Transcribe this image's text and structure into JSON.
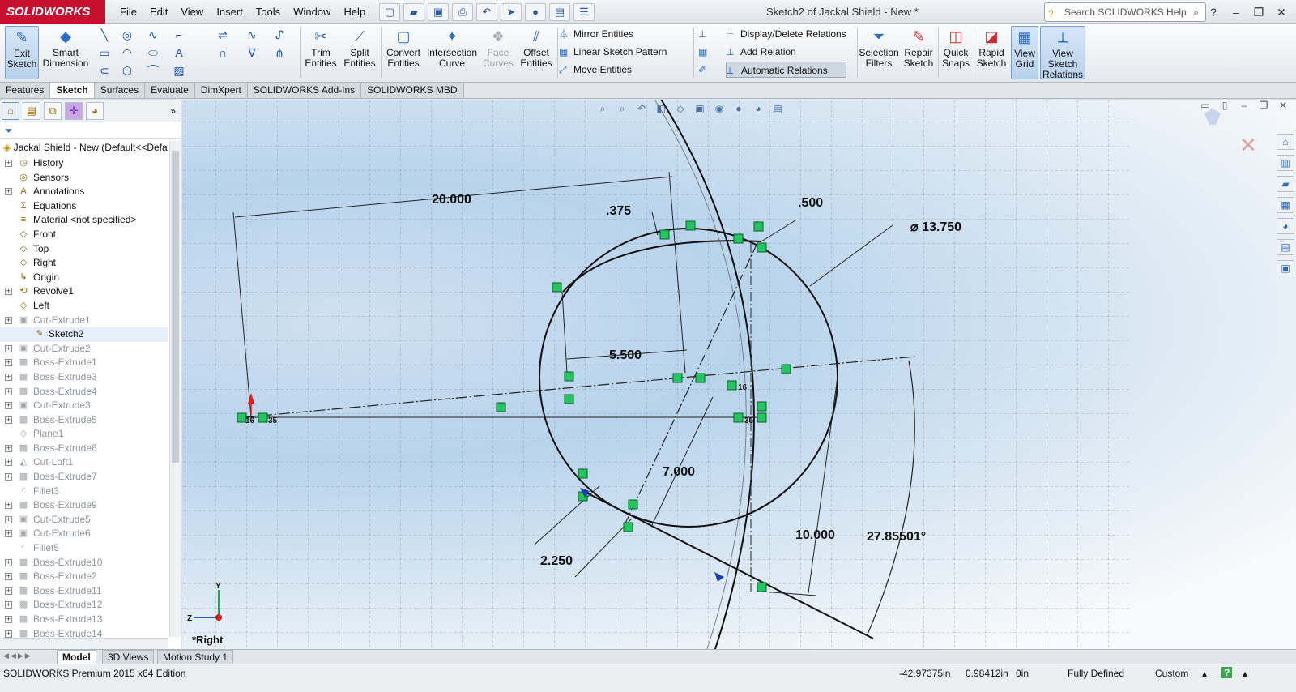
{
  "app": {
    "logo": "SOLIDWORKS",
    "document_title": "Sketch2 of Jackal Shield - New *"
  },
  "menu": [
    "File",
    "Edit",
    "View",
    "Insert",
    "Tools",
    "Window",
    "Help"
  ],
  "search": {
    "placeholder": "Search SOLIDWORKS Help"
  },
  "ribbon": {
    "exit_sketch": "Exit Sketch",
    "smart_dimension": "Smart Dimension",
    "trim_entities": "Trim Entities",
    "split_entities": "Split Entities",
    "convert_entities": "Convert Entities",
    "intersection_curve": "Intersection Curve",
    "face_curves": "Face Curves",
    "offset_entities": "Offset Entities",
    "mirror_entities": "Mirror Entities",
    "linear_sketch_pattern": "Linear Sketch Pattern",
    "move_entities": "Move Entities",
    "display_delete_relations": "Display/Delete Relations",
    "add_relation": "Add Relation",
    "automatic_relations": "Automatic Relations",
    "selection_filters": "Selection Filters",
    "repair_sketch": "Repair Sketch",
    "quick_snaps": "Quick Snaps",
    "rapid_sketch": "Rapid Sketch",
    "view_grid": "View Grid",
    "view_sketch_relations": "View Sketch Relations"
  },
  "command_tabs": [
    "Features",
    "Sketch",
    "Surfaces",
    "Evaluate",
    "DimXpert",
    "SOLIDWORKS Add-Ins",
    "SOLIDWORKS MBD"
  ],
  "tree": {
    "root": "Jackal Shield - New  (Default<<Defa",
    "items": [
      {
        "label": "History",
        "icon": "history-icon",
        "expandable": true,
        "dim": false
      },
      {
        "label": "Sensors",
        "icon": "sensor-icon",
        "expandable": false,
        "dim": false
      },
      {
        "label": "Annotations",
        "icon": "annotation-icon",
        "expandable": true,
        "dim": false
      },
      {
        "label": "Equations",
        "icon": "equation-icon",
        "expandable": false,
        "dim": false
      },
      {
        "label": "Material <not specified>",
        "icon": "material-icon",
        "expandable": false,
        "dim": false
      },
      {
        "label": "Front",
        "icon": "plane-icon",
        "expandable": false,
        "dim": false
      },
      {
        "label": "Top",
        "icon": "plane-icon",
        "expandable": false,
        "dim": false
      },
      {
        "label": "Right",
        "icon": "plane-icon",
        "expandable": false,
        "dim": false
      },
      {
        "label": "Origin",
        "icon": "origin-icon",
        "expandable": false,
        "dim": false
      },
      {
        "label": "Revolve1",
        "icon": "revolve-icon",
        "expandable": true,
        "dim": false
      },
      {
        "label": "Left",
        "icon": "plane-icon",
        "expandable": false,
        "dim": false
      },
      {
        "label": "Cut-Extrude1",
        "icon": "cut-extrude-icon",
        "expandable": true,
        "dim": true
      },
      {
        "label": "Sketch2",
        "icon": "sketch-icon",
        "expandable": false,
        "dim": false,
        "child": true
      },
      {
        "label": "Cut-Extrude2",
        "icon": "cut-extrude-icon",
        "expandable": true,
        "dim": true
      },
      {
        "label": "Boss-Extrude1",
        "icon": "boss-extrude-icon",
        "expandable": true,
        "dim": true
      },
      {
        "label": "Boss-Extrude3",
        "icon": "boss-extrude-icon",
        "expandable": true,
        "dim": true
      },
      {
        "label": "Boss-Extrude4",
        "icon": "boss-extrude-icon",
        "expandable": true,
        "dim": true
      },
      {
        "label": "Cut-Extrude3",
        "icon": "cut-extrude-icon",
        "expandable": true,
        "dim": true
      },
      {
        "label": "Boss-Extrude5",
        "icon": "boss-extrude-icon",
        "expandable": true,
        "dim": true
      },
      {
        "label": "Plane1",
        "icon": "plane-icon",
        "expandable": false,
        "dim": true
      },
      {
        "label": "Boss-Extrude6",
        "icon": "boss-extrude-icon",
        "expandable": true,
        "dim": true
      },
      {
        "label": "Cut-Loft1",
        "icon": "loft-icon",
        "expandable": true,
        "dim": true
      },
      {
        "label": "Boss-Extrude7",
        "icon": "boss-extrude-icon",
        "expandable": true,
        "dim": true
      },
      {
        "label": "Fillet3",
        "icon": "fillet-icon",
        "expandable": false,
        "dim": true
      },
      {
        "label": "Boss-Extrude9",
        "icon": "boss-extrude-icon",
        "expandable": true,
        "dim": true
      },
      {
        "label": "Cut-Extrude5",
        "icon": "cut-extrude-icon",
        "expandable": true,
        "dim": true
      },
      {
        "label": "Cut-Extrude6",
        "icon": "cut-extrude-icon",
        "expandable": true,
        "dim": true
      },
      {
        "label": "Fillet5",
        "icon": "fillet-icon",
        "expandable": false,
        "dim": true
      },
      {
        "label": "Boss-Extrude10",
        "icon": "boss-extrude-icon",
        "expandable": true,
        "dim": true
      },
      {
        "label": "Boss-Extrude2",
        "icon": "boss-extrude-icon",
        "expandable": true,
        "dim": true
      },
      {
        "label": "Boss-Extrude11",
        "icon": "boss-extrude-icon",
        "expandable": true,
        "dim": true
      },
      {
        "label": "Boss-Extrude12",
        "icon": "boss-extrude-icon",
        "expandable": true,
        "dim": true
      },
      {
        "label": "Boss-Extrude13",
        "icon": "boss-extrude-icon",
        "expandable": true,
        "dim": true
      },
      {
        "label": "Boss-Extrude14",
        "icon": "boss-extrude-icon",
        "expandable": true,
        "dim": true
      }
    ]
  },
  "sketch": {
    "dimensions": {
      "d20": "20.000",
      "d375": ".375",
      "d500": ".500",
      "diameter": "⌀ 13.750",
      "d5500": "5.500",
      "d7000": "7.000",
      "d2250": "2.250",
      "d10000": "10.000",
      "angle": "27.85501°"
    },
    "relation_labels": {
      "r16a": "16",
      "r35a": "35",
      "r16b": "16",
      "r35b": "35"
    },
    "axis_y": "Y",
    "axis_z": "Z",
    "view_label": "*Right"
  },
  "bottom_tabs": [
    "Model",
    "3D Views",
    "Motion Study 1"
  ],
  "status": {
    "edition": "SOLIDWORKS Premium 2015 x64 Edition",
    "x": "-42.97375in",
    "y": "0.98412in",
    "z": "0in",
    "state": "Fully Defined",
    "units": "Custom"
  },
  "colors": {
    "logo_bg": "#c8102e",
    "relation_marker": "#22c55e",
    "accent": "#2b6cc4"
  }
}
